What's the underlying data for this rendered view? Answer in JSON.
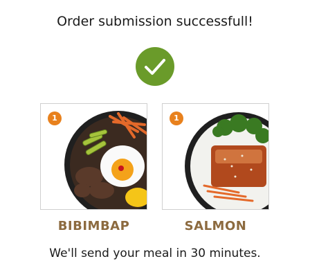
{
  "header": {
    "title": "Order submission successfull!"
  },
  "status_icon": {
    "icon": "checkmark-circle-icon",
    "color": "#6a9b2a"
  },
  "items": [
    {
      "name": "BIBIMBAP",
      "quantity": "1",
      "image": "bibimbap-bowl-image"
    },
    {
      "name": "SALMON",
      "quantity": "1",
      "image": "salmon-bowl-image"
    }
  ],
  "footer": {
    "message": "We'll send your meal in 30 minutes."
  },
  "colors": {
    "badge": "#e8811d",
    "item_name": "#8c6a3f"
  }
}
